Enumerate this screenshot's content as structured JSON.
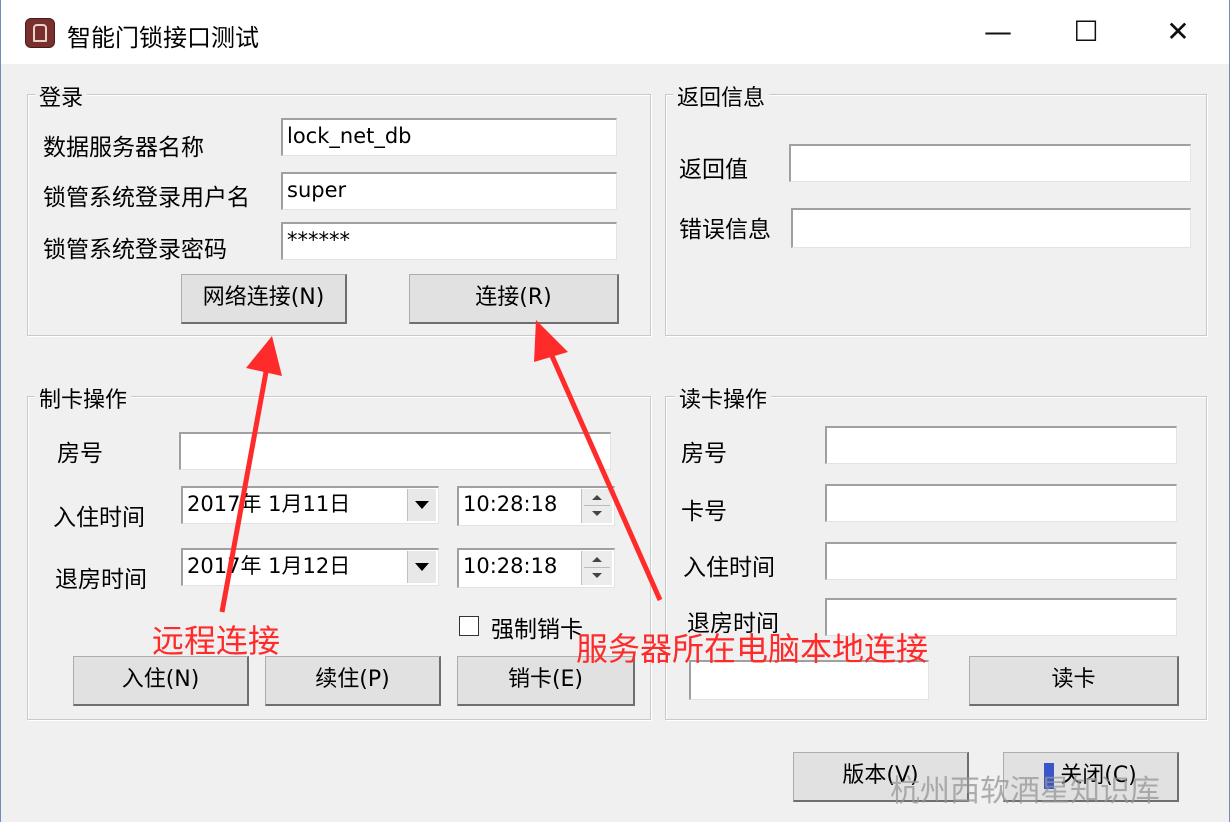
{
  "window": {
    "title": "智能门锁接口测试",
    "controls": {
      "minimize": "—",
      "maximize": "☐",
      "close": "✕"
    }
  },
  "login": {
    "legend": "登录",
    "server_label": "数据服务器名称",
    "server_value": "lock_net_db",
    "user_label": "锁管系统登录用户名",
    "user_value": "super",
    "pwd_label": "锁管系统登录密码",
    "pwd_value": "******",
    "net_btn": "网络连接(N)",
    "conn_btn": "连接(R)"
  },
  "ret": {
    "legend": "返回信息",
    "value_label": "返回值",
    "value": "",
    "err_label": "错误信息",
    "err": ""
  },
  "make": {
    "legend": "制卡操作",
    "room_label": "房号",
    "room_value": "",
    "checkin_label": "入住时间",
    "checkin_date": "2017年  1月11日",
    "checkin_time": "10:28:18",
    "checkout_label": "退房时间",
    "checkout_date": "2017年  1月12日",
    "checkout_time": "10:28:18",
    "force_label": "强制销卡",
    "btn_checkin": "入住(N)",
    "btn_extend": "续住(P)",
    "btn_cancel": "销卡(E)"
  },
  "read": {
    "legend": "读卡操作",
    "room_label": "房号",
    "card_label": "卡号",
    "in_label": "入住时间",
    "out_label": "退房时间",
    "room_value": "",
    "card_value": "",
    "in_value": "",
    "out_value": "",
    "extra_value": "",
    "btn_read": "读卡"
  },
  "footer": {
    "btn_version": "版本(V)",
    "btn_close": "关闭(C)"
  },
  "annotations": {
    "remote": "远程连接",
    "local": "服务器所在电脑本地连接",
    "color": "#ff2a2a"
  },
  "watermark": "杭州西软酒星知识库"
}
